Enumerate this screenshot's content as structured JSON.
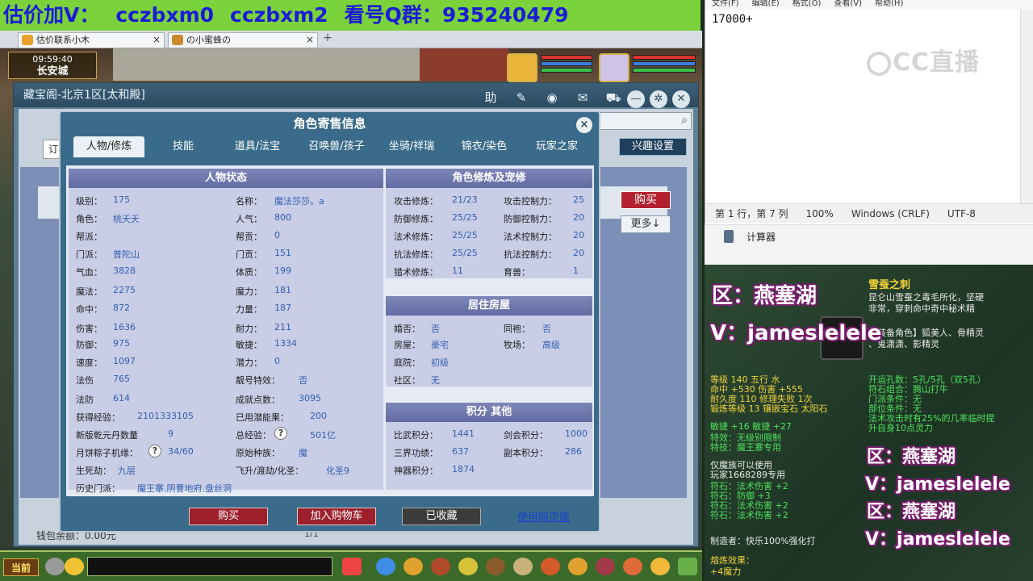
{
  "banner": {
    "parts": [
      "估价加V：",
      "cczbxm0",
      "cczbxm2",
      "看号Q群：935240479"
    ]
  },
  "browser_tabs": [
    {
      "label": "估价联系小木"
    },
    {
      "label": "の小蜜蜂の"
    }
  ],
  "game": {
    "time": "09:59:40",
    "city": "长安城"
  },
  "cbg_window": {
    "title": "藏宝阁-北京1区[太和殿]",
    "interest_button": "兴趣设置",
    "buy_button": "购买",
    "more_button": "更多↓",
    "wallet": "钱包余额：0.00元",
    "pager": "1/1",
    "left_cap": "订"
  },
  "dialog": {
    "title": "角色寄售信息",
    "close": "×",
    "tabs": [
      "人物/修炼",
      "技能",
      "道具/法宝",
      "召唤兽/孩子",
      "坐骑/祥瑞",
      "锦衣/染色",
      "玩家之家"
    ],
    "active_tab": 0,
    "sections": {
      "status": "人物状态",
      "cultivation": "角色修炼及宠修",
      "house": "居住房屋",
      "score": "积分 其他"
    },
    "status_left": [
      {
        "k": "级别：",
        "v": "175"
      },
      {
        "k": "角色：",
        "v": "桃夭夭"
      },
      {
        "k": "帮派：",
        "v": ""
      },
      {
        "k": "门派：",
        "v": "普陀山"
      },
      {
        "k": "气血：",
        "v": "3828"
      },
      {
        "k": "魔法：",
        "v": "2275"
      },
      {
        "k": "命中：",
        "v": "872"
      },
      {
        "k": "伤害：",
        "v": "1636"
      },
      {
        "k": "防御：",
        "v": "975"
      },
      {
        "k": "速度：",
        "v": "1097"
      },
      {
        "k": "法伤",
        "v": "765"
      },
      {
        "k": "法防",
        "v": "614"
      },
      {
        "k": "获得经验：",
        "v": "2101333105"
      },
      {
        "k": "新版乾元丹数量",
        "v": "9"
      },
      {
        "k": "月饼粽子机缘：",
        "v": "34/60"
      },
      {
        "k": "生死劫：",
        "v": "九层"
      },
      {
        "k": "历史门派：",
        "v": "魔王寨,阴曹地府,盘丝洞"
      }
    ],
    "status_right": [
      {
        "k": "名称：",
        "v": "魔法莎莎。a"
      },
      {
        "k": "人气：",
        "v": "800"
      },
      {
        "k": "帮贡：",
        "v": "0"
      },
      {
        "k": "门贡：",
        "v": "151"
      },
      {
        "k": "体质：",
        "v": "199"
      },
      {
        "k": "魔力：",
        "v": "181"
      },
      {
        "k": "力量：",
        "v": "187"
      },
      {
        "k": "耐力：",
        "v": "211"
      },
      {
        "k": "敏捷：",
        "v": "1334"
      },
      {
        "k": "潜力：",
        "v": "0"
      },
      {
        "k": "靓号特效：",
        "v": "否"
      },
      {
        "k": "成就点数：",
        "v": "3095"
      },
      {
        "k": "已用潜能果：",
        "v": "200"
      },
      {
        "k": "总经验：",
        "v": "501亿"
      },
      {
        "k": "原始种族：",
        "v": "魔"
      },
      {
        "k": "飞升/渡劫/化圣：",
        "v": "化圣9"
      }
    ],
    "cultivation_left": [
      {
        "k": "攻击修炼：",
        "v": "21/23"
      },
      {
        "k": "防御修炼：",
        "v": "25/25"
      },
      {
        "k": "法术修炼：",
        "v": "25/25"
      },
      {
        "k": "抗法修炼：",
        "v": "25/25"
      },
      {
        "k": "猎术修炼：",
        "v": "11"
      }
    ],
    "cultivation_right": [
      {
        "k": "攻击控制力：",
        "v": "25"
      },
      {
        "k": "防御控制力：",
        "v": "20"
      },
      {
        "k": "法术控制力：",
        "v": "20"
      },
      {
        "k": "抗法控制力：",
        "v": "20"
      },
      {
        "k": "育兽：",
        "v": "1"
      }
    ],
    "house_left": [
      {
        "k": "婚否：",
        "v": "否"
      },
      {
        "k": "房屋：",
        "v": "豪宅"
      },
      {
        "k": "庭院：",
        "v": "初级"
      },
      {
        "k": "社区：",
        "v": "无"
      }
    ],
    "house_right": [
      {
        "k": "同袍：",
        "v": "否"
      },
      {
        "k": "牧场：",
        "v": "高级"
      }
    ],
    "score_left": [
      {
        "k": "比武积分：",
        "v": "1441"
      },
      {
        "k": "三界功绩：",
        "v": "637"
      },
      {
        "k": "神器积分：",
        "v": "1874"
      }
    ],
    "score_right": [
      {
        "k": "剑会积分：",
        "v": "1000"
      },
      {
        "k": "副本积分：",
        "v": "286"
      }
    ],
    "buttons": {
      "buy": "购买",
      "add_cart": "加入购物车",
      "collected": "已收藏",
      "web": "使用网页版"
    }
  },
  "taskbar": {
    "current": "当前"
  },
  "notepad": {
    "menu": [
      "文件(F)",
      "编辑(E)",
      "格式(O)",
      "查看(V)",
      "帮助(H)"
    ],
    "content": "17000+",
    "status": [
      "第 1 行，第 7 列",
      "100%",
      "Windows (CRLF)",
      "UTF-8"
    ]
  },
  "watermark": "CC直播",
  "calculator": {
    "label": "计算器"
  },
  "overlay": {
    "zone1": "区：燕塞湖",
    "v1": "V：jameslelele",
    "zone2": "区：燕塞湖",
    "v2": "V：jameslelele",
    "zone3": "区：燕塞湖",
    "v3": "V：jameslelele"
  },
  "item": {
    "name": "雪蚕之刺",
    "desc1": "昆仑山雪蚕之毒毛所化，坚硬",
    "desc2": "非常，穿刺命中奇中秘术精",
    "desc3": "【装备角色】狐美人、骨精灵",
    "desc4": "、鬼潇潇、影精灵",
    "stats1": "等级 140  五行 水",
    "stats2": "命中 +530  伤害 +555",
    "stats3": "耐久度 110  修理失败 1次",
    "stats4": "锻炼等级 13  镶嵌宝石 太阳石",
    "stats5": "敏捷 +16  敏捷 +27",
    "special1": "开运孔数：5孔/5孔（双5孔）",
    "special2": "符石组合：腾山打牛",
    "special3": "门派条件：无",
    "special4": "部位条件：无",
    "special5": "法术攻击时有25%的几率临时提",
    "special6": "升自身10点灵力",
    "skill1": "特效：无级别限制",
    "skill2": "特技：魔王寨专用",
    "skill3": "仅魔族可以使用",
    "skill4": "玩家1668289专用",
    "rune1": "符石：法术伤害 +2",
    "rune2": "符石：防御 +3",
    "rune3": "符石：法术伤害 +2",
    "rune4": "符石：法术伤害 +2",
    "maker": "制造者：快乐100%强化打",
    "refine": "熔炼效果：",
    "refine_val": "+4魔力"
  },
  "colors": {
    "banner_bg": "#7ad33a",
    "banner_text": "#1b1bd8",
    "dialog_bg": "#3a6b8a",
    "section_head": "#6e78ad",
    "value_blue": "#2f5fb2",
    "buy_red": "#9c1f2b",
    "overlay_outline": "#7a1c6e"
  }
}
